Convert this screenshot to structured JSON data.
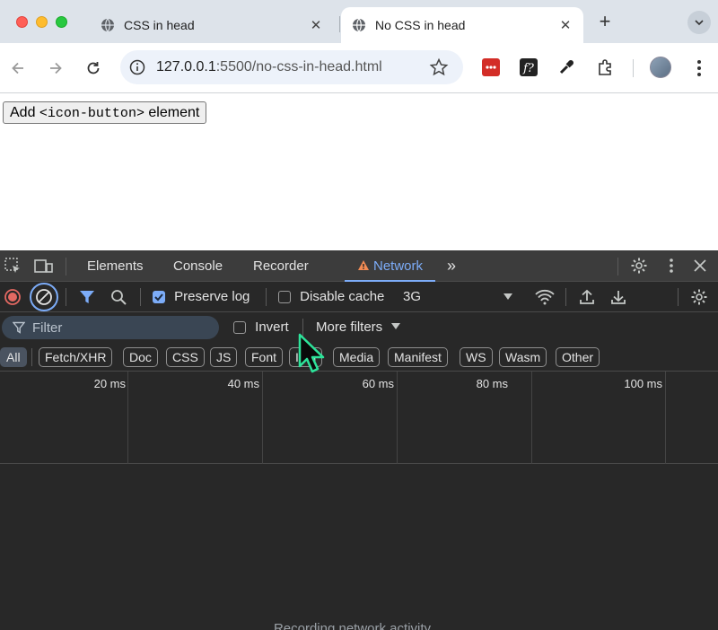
{
  "browser": {
    "tabs": [
      {
        "title": "CSS in head",
        "active": false
      },
      {
        "title": "No CSS in head",
        "active": true
      }
    ],
    "new_tab_label": "+",
    "address": {
      "host": "127.0.0.1",
      "path": ":5500/no-css-in-head.html"
    }
  },
  "page": {
    "button_prefix": "Add ",
    "button_code": "<icon-button>",
    "button_suffix": " element"
  },
  "devtools": {
    "panels": [
      "Elements",
      "Console",
      "Recorder",
      "Network"
    ],
    "active_panel": "Network",
    "more_panels": "»",
    "network_toolbar": {
      "preserve_log_label": "Preserve log",
      "preserve_log_checked": true,
      "disable_cache_label": "Disable cache",
      "disable_cache_checked": false,
      "throttling_value": "3G"
    },
    "filter": {
      "placeholder": "Filter",
      "invert_label": "Invert",
      "more_filters_label": "More filters"
    },
    "type_filters": [
      "All",
      "Fetch/XHR",
      "Doc",
      "CSS",
      "JS",
      "Font",
      "Img",
      "Media",
      "Manifest",
      "WS",
      "Wasm",
      "Other"
    ],
    "active_type_filter": "All",
    "timeline_ticks": [
      "20 ms",
      "40 ms",
      "60 ms",
      "80 ms",
      "100 ms"
    ],
    "empty_message": "Recording network activity…"
  },
  "colors": {
    "accent": "#7cacf8",
    "record_red": "#e46962",
    "devtools_bg": "#282828"
  }
}
